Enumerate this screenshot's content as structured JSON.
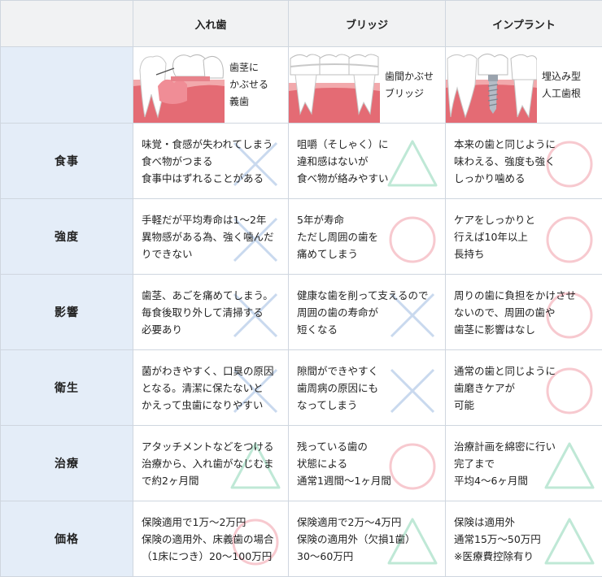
{
  "columns": [
    "入れ歯",
    "ブリッジ",
    "インプラント"
  ],
  "image_row": {
    "labels": [
      "歯茎に\nかぶせる\n義歯",
      "歯間かぶせ\nブリッジ",
      "埋込み型\n人工歯根"
    ]
  },
  "rows": [
    {
      "label": "食事",
      "cells": [
        {
          "text": "味覚・食感が失われてしまう\n食べ物がつまる\n食事中はずれることがある",
          "mark": "cross"
        },
        {
          "text": "咀嚼（そしゃく）に\n違和感はないが\n食べ物が絡みやすい",
          "mark": "triangle"
        },
        {
          "text": "本来の歯と同じように\n味わえる、強度も強く\nしっかり噛める",
          "mark": "circle"
        }
      ]
    },
    {
      "label": "強度",
      "cells": [
        {
          "text": "手軽だが平均寿命は1〜2年\n異物感がある為、強く噛んだ\nりできない",
          "mark": "cross"
        },
        {
          "text": "5年が寿命\nただし周囲の歯を\n痛めてしまう",
          "mark": "circle"
        },
        {
          "text": "ケアをしっかりと\n行えば10年以上\n長持ち",
          "mark": "circle"
        }
      ]
    },
    {
      "label": "影響",
      "cells": [
        {
          "text": "歯茎、あごを痛めてしまう。\n毎食後取り外して清掃する\n必要あり",
          "mark": "cross"
        },
        {
          "text": "健康な歯を削って支えるので\n周囲の歯の寿命が\n短くなる",
          "mark": "cross"
        },
        {
          "text": "周りの歯に負担をかけさせ\nないので、周囲の歯や\n歯茎に影響はなし",
          "mark": "circle"
        }
      ]
    },
    {
      "label": "衛生",
      "cells": [
        {
          "text": "菌がわきやすく、口臭の原因\nとなる。清潔に保たないと\nかえって虫歯になりやすい",
          "mark": "cross"
        },
        {
          "text": "隙間ができやすく\n歯周病の原因にも\nなってしまう",
          "mark": "cross"
        },
        {
          "text": "通常の歯と同じように\n歯磨きケアが\n可能",
          "mark": "circle"
        }
      ]
    },
    {
      "label": "治療",
      "cells": [
        {
          "text": "アタッチメントなどをつける\n治療から、入れ歯がなじむま\nで約2ヶ月間",
          "mark": "triangle"
        },
        {
          "text": "残っている歯の\n状態による\n通常1週間〜1ヶ月間",
          "mark": "circle"
        },
        {
          "text": "治療計画を綿密に行い\n完了まで\n平均4〜6ヶ月間",
          "mark": "triangle"
        }
      ]
    },
    {
      "label": "価格",
      "cells": [
        {
          "text": "保険適用で1万〜2万円\n保険の適用外、床義歯の場合\n（1床につき）20〜100万円",
          "mark": "circle"
        },
        {
          "text": "保険適用で2万〜4万円\n保険の適用外（欠損1歯）\n30〜60万円",
          "mark": "triangle"
        },
        {
          "text": "保険は適用外\n通常15万〜50万円\n※医療費控除有り",
          "mark": "triangle"
        }
      ]
    }
  ],
  "mark_colors": {
    "circle": "#f7c9cf",
    "cross": "#c9d9ee",
    "triangle": "#bfe8d6"
  }
}
